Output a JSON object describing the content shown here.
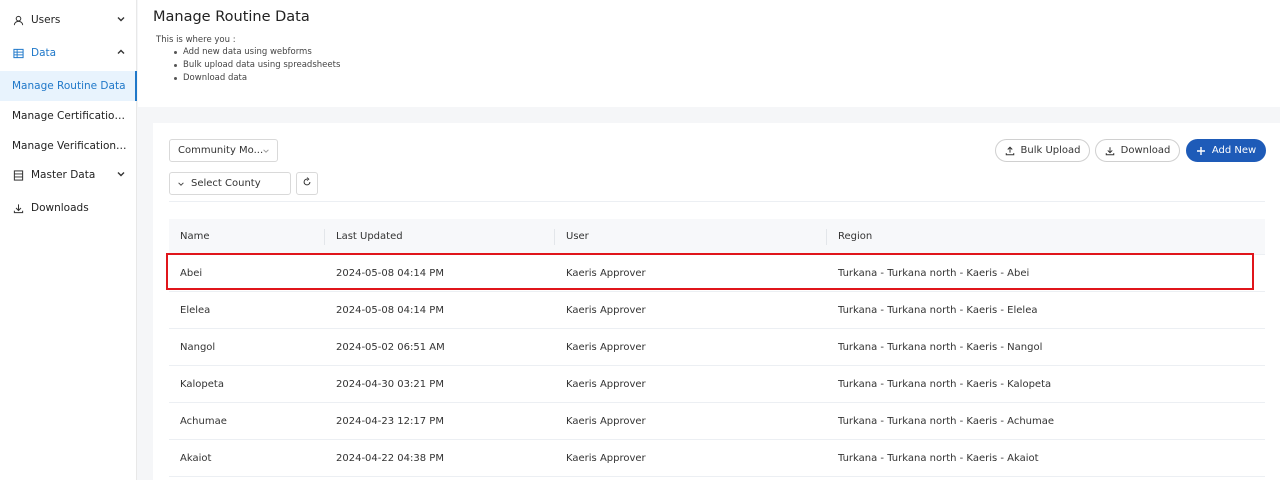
{
  "sidebar": {
    "users": "Users",
    "data": "Data",
    "sub_items": [
      "Manage Routine Data",
      "Manage Certification ...",
      "Manage Verification D..."
    ],
    "master_data": "Master Data",
    "downloads": "Downloads"
  },
  "header": {
    "title": "Manage Routine Data",
    "intro": "This is where you :",
    "bullets": [
      "Add new data using webforms",
      "Bulk upload data using spreadsheets",
      "Download data"
    ]
  },
  "filters": {
    "form_select": "Community Mo...",
    "county_select": "Select County"
  },
  "actions": {
    "bulk_upload": "Bulk Upload",
    "download": "Download",
    "add_new": "Add New"
  },
  "table": {
    "columns": [
      "Name",
      "Last Updated",
      "User",
      "Region"
    ],
    "rows": [
      {
        "name": "Abei",
        "updated": "2024-05-08 04:14 PM",
        "user": "Kaeris Approver",
        "region": "Turkana - Turkana north - Kaeris - Abei"
      },
      {
        "name": "Elelea",
        "updated": "2024-05-08 04:14 PM",
        "user": "Kaeris Approver",
        "region": "Turkana - Turkana north - Kaeris - Elelea"
      },
      {
        "name": "Nangol",
        "updated": "2024-05-02 06:51 AM",
        "user": "Kaeris Approver",
        "region": "Turkana - Turkana north - Kaeris - Nangol"
      },
      {
        "name": "Kalopeta",
        "updated": "2024-04-30 03:21 PM",
        "user": "Kaeris Approver",
        "region": "Turkana - Turkana north - Kaeris - Kalopeta"
      },
      {
        "name": "Achumae",
        "updated": "2024-04-23 12:17 PM",
        "user": "Kaeris Approver",
        "region": "Turkana - Turkana north - Kaeris - Achumae"
      },
      {
        "name": "Akaiot",
        "updated": "2024-04-22 04:38 PM",
        "user": "Kaeris Approver",
        "region": "Turkana - Turkana north - Kaeris - Akaiot"
      }
    ]
  },
  "colors": {
    "accent": "#1f78c9",
    "primary_button": "#1e5bb8",
    "highlight": "#e0151b"
  }
}
